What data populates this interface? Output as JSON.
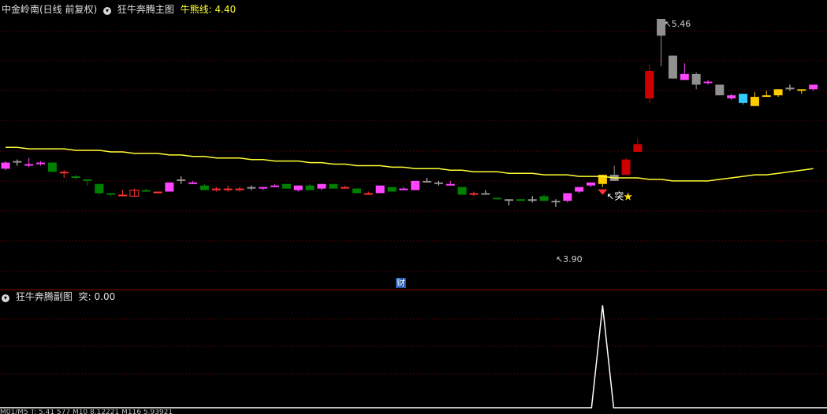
{
  "main_header": {
    "stock": "中金岭南(日线 前复权)",
    "indicator": "狂牛奔腾主图",
    "line_label": "牛熊线: 4.40",
    "colors": {
      "stock": "#e0e0e0",
      "indicator": "#e0e0e0",
      "line_label": "#ffff33"
    }
  },
  "sub_header": {
    "indicator": "狂牛奔腾副图",
    "value_label": "突: 0.00"
  },
  "annotations": {
    "high": "5.46",
    "low": "3.90",
    "signal": "突",
    "signal_icon": "star",
    "finance_badge": "财"
  },
  "bottom_strip": "M01/M5 T: 5.41 577 M10 8.12221 M116 5.93921",
  "colors": {
    "background": "#000000",
    "grid": "#8b0000",
    "up": "#ff44ff",
    "down": "#008000",
    "doji": "#ff3333",
    "bull_line": "#ffff33",
    "gray": "#909090",
    "red_solid": "#cc0000",
    "gold": "#ffcc00",
    "blue": "#33ccff",
    "sub_line": "#ffffff"
  },
  "chart_data": {
    "type": "candlestick",
    "bull_bear_line": [
      4.62,
      4.62,
      4.61,
      4.61,
      4.61,
      4.61,
      4.6,
      4.6,
      4.6,
      4.59,
      4.59,
      4.58,
      4.58,
      4.58,
      4.57,
      4.57,
      4.56,
      4.56,
      4.55,
      4.55,
      4.55,
      4.54,
      4.54,
      4.53,
      4.53,
      4.53,
      4.52,
      4.52,
      4.51,
      4.51,
      4.5,
      4.5,
      4.5,
      4.49,
      4.49,
      4.48,
      4.48,
      4.48,
      4.47,
      4.47,
      4.46,
      4.46,
      4.46,
      4.45,
      4.45,
      4.45,
      4.44,
      4.44,
      4.44,
      4.43,
      4.43,
      4.43,
      4.42,
      4.42,
      4.42,
      4.41,
      4.41,
      4.4,
      4.4,
      4.4,
      4.4,
      4.41,
      4.42,
      4.43,
      4.44,
      4.44,
      4.45,
      4.46,
      4.47,
      4.48
    ],
    "candles": [
      {
        "o": 4.52,
        "c": 4.48,
        "h": 4.53,
        "l": 4.47,
        "k": "up"
      },
      {
        "o": 4.53,
        "c": 4.52,
        "h": 4.54,
        "l": 4.5,
        "k": "gray"
      },
      {
        "o": 4.5,
        "c": 4.51,
        "h": 4.55,
        "l": 4.49,
        "k": "up"
      },
      {
        "o": 4.52,
        "c": 4.51,
        "h": 4.53,
        "l": 4.5,
        "k": "up"
      },
      {
        "o": 4.52,
        "c": 4.46,
        "h": 4.52,
        "l": 4.46,
        "k": "down"
      },
      {
        "o": 4.46,
        "c": 4.45,
        "h": 4.47,
        "l": 4.42,
        "k": "doji"
      },
      {
        "o": 4.43,
        "c": 4.42,
        "h": 4.44,
        "l": 4.41,
        "k": "down"
      },
      {
        "o": 4.41,
        "c": 4.4,
        "h": 4.41,
        "l": 4.37,
        "k": "down"
      },
      {
        "o": 4.38,
        "c": 4.32,
        "h": 4.38,
        "l": 4.31,
        "k": "down"
      },
      {
        "o": 4.32,
        "c": 4.31,
        "h": 4.32,
        "l": 4.3,
        "k": "down"
      },
      {
        "o": 4.3,
        "c": 4.31,
        "h": 4.34,
        "l": 4.3,
        "k": "doji"
      },
      {
        "o": 4.3,
        "c": 4.34,
        "h": 4.35,
        "l": 4.3,
        "k": "hollow"
      },
      {
        "o": 4.34,
        "c": 4.33,
        "h": 4.35,
        "l": 4.33,
        "k": "down"
      },
      {
        "o": 4.33,
        "c": 4.32,
        "h": 4.33,
        "l": 4.32,
        "k": "doji"
      },
      {
        "o": 4.33,
        "c": 4.39,
        "h": 4.39,
        "l": 4.33,
        "k": "up"
      },
      {
        "o": 4.41,
        "c": 4.4,
        "h": 4.43,
        "l": 4.38,
        "k": "gray"
      },
      {
        "o": 4.38,
        "c": 4.39,
        "h": 4.4,
        "l": 4.38,
        "k": "up"
      },
      {
        "o": 4.37,
        "c": 4.34,
        "h": 4.38,
        "l": 4.34,
        "k": "down"
      },
      {
        "o": 4.35,
        "c": 4.35,
        "h": 4.36,
        "l": 4.33,
        "k": "doji"
      },
      {
        "o": 4.35,
        "c": 4.35,
        "h": 4.37,
        "l": 4.33,
        "k": "doji"
      },
      {
        "o": 4.35,
        "c": 4.34,
        "h": 4.36,
        "l": 4.33,
        "k": "doji"
      },
      {
        "o": 4.35,
        "c": 4.36,
        "h": 4.37,
        "l": 4.34,
        "k": "gray"
      },
      {
        "o": 4.35,
        "c": 4.36,
        "h": 4.36,
        "l": 4.34,
        "k": "up"
      },
      {
        "o": 4.36,
        "c": 4.37,
        "h": 4.38,
        "l": 4.36,
        "k": "up"
      },
      {
        "o": 4.38,
        "c": 4.35,
        "h": 4.38,
        "l": 4.35,
        "k": "down"
      },
      {
        "o": 4.34,
        "c": 4.37,
        "h": 4.37,
        "l": 4.33,
        "k": "up"
      },
      {
        "o": 4.37,
        "c": 4.34,
        "h": 4.38,
        "l": 4.34,
        "k": "down"
      },
      {
        "o": 4.35,
        "c": 4.38,
        "h": 4.38,
        "l": 4.34,
        "k": "up"
      },
      {
        "o": 4.38,
        "c": 4.35,
        "h": 4.38,
        "l": 4.35,
        "k": "down"
      },
      {
        "o": 4.36,
        "c": 4.35,
        "h": 4.37,
        "l": 4.35,
        "k": "doji"
      },
      {
        "o": 4.35,
        "c": 4.32,
        "h": 4.35,
        "l": 4.32,
        "k": "down"
      },
      {
        "o": 4.32,
        "c": 4.32,
        "h": 4.33,
        "l": 4.31,
        "k": "doji"
      },
      {
        "o": 4.32,
        "c": 4.37,
        "h": 4.37,
        "l": 4.32,
        "k": "up"
      },
      {
        "o": 4.36,
        "c": 4.33,
        "h": 4.36,
        "l": 4.33,
        "k": "down"
      },
      {
        "o": 4.34,
        "c": 4.35,
        "h": 4.36,
        "l": 4.34,
        "k": "up"
      },
      {
        "o": 4.34,
        "c": 4.4,
        "h": 4.4,
        "l": 4.34,
        "k": "up"
      },
      {
        "o": 4.4,
        "c": 4.4,
        "h": 4.42,
        "l": 4.39,
        "k": "gray"
      },
      {
        "o": 4.39,
        "c": 4.38,
        "h": 4.4,
        "l": 4.37,
        "k": "gray"
      },
      {
        "o": 4.37,
        "c": 4.38,
        "h": 4.4,
        "l": 4.37,
        "k": "up"
      },
      {
        "o": 4.36,
        "c": 4.31,
        "h": 4.36,
        "l": 4.31,
        "k": "down"
      },
      {
        "o": 4.32,
        "c": 4.31,
        "h": 4.33,
        "l": 4.3,
        "k": "doji"
      },
      {
        "o": 4.32,
        "c": 4.32,
        "h": 4.34,
        "l": 4.31,
        "k": "gray"
      },
      {
        "o": 4.29,
        "c": 4.28,
        "h": 4.29,
        "l": 4.28,
        "k": "down"
      },
      {
        "o": 4.28,
        "c": 4.28,
        "h": 4.28,
        "l": 4.24,
        "k": "gray"
      },
      {
        "o": 4.28,
        "c": 4.27,
        "h": 4.28,
        "l": 4.27,
        "k": "down"
      },
      {
        "o": 4.28,
        "c": 4.28,
        "h": 4.3,
        "l": 4.26,
        "k": "gray"
      },
      {
        "o": 4.27,
        "c": 4.3,
        "h": 4.31,
        "l": 4.27,
        "k": "down"
      },
      {
        "o": 4.27,
        "c": 4.27,
        "h": 4.28,
        "l": 4.23,
        "k": "gray"
      },
      {
        "o": 4.27,
        "c": 4.32,
        "h": 4.32,
        "l": 4.26,
        "k": "up"
      },
      {
        "o": 4.33,
        "c": 4.36,
        "h": 4.36,
        "l": 4.32,
        "k": "up"
      },
      {
        "o": 4.37,
        "c": 4.39,
        "h": 4.39,
        "l": 4.36,
        "k": "up"
      },
      {
        "o": 4.38,
        "c": 4.44,
        "h": 4.44,
        "l": 4.36,
        "k": "gold"
      },
      {
        "o": 4.4,
        "c": 4.44,
        "h": 4.5,
        "l": 4.4,
        "k": "gray"
      },
      {
        "o": 4.44,
        "c": 4.54,
        "h": 4.55,
        "l": 4.44,
        "k": "red"
      },
      {
        "o": 4.59,
        "c": 4.64,
        "h": 4.68,
        "l": 4.59,
        "k": "red"
      },
      {
        "o": 4.94,
        "c": 5.12,
        "h": 5.16,
        "l": 4.91,
        "k": "red"
      },
      {
        "o": 5.35,
        "c": 5.46,
        "h": 5.46,
        "l": 5.15,
        "k": "gray"
      },
      {
        "o": 5.22,
        "c": 5.07,
        "h": 5.22,
        "l": 5.07,
        "k": "gray"
      },
      {
        "o": 5.1,
        "c": 5.06,
        "h": 5.17,
        "l": 5.06,
        "k": "up"
      },
      {
        "o": 5.1,
        "c": 5.03,
        "h": 5.11,
        "l": 5.0,
        "k": "gray"
      },
      {
        "o": 5.05,
        "c": 5.04,
        "h": 5.06,
        "l": 5.03,
        "k": "up"
      },
      {
        "o": 5.03,
        "c": 4.96,
        "h": 5.03,
        "l": 4.96,
        "k": "gray"
      },
      {
        "o": 4.96,
        "c": 4.94,
        "h": 4.97,
        "l": 4.93,
        "k": "up"
      },
      {
        "o": 4.97,
        "c": 4.91,
        "h": 4.97,
        "l": 4.9,
        "k": "blue"
      },
      {
        "o": 4.95,
        "c": 4.89,
        "h": 4.98,
        "l": 4.89,
        "k": "gold"
      },
      {
        "o": 4.96,
        "c": 4.96,
        "h": 4.99,
        "l": 4.95,
        "k": "gold"
      },
      {
        "o": 4.96,
        "c": 5.0,
        "h": 5.0,
        "l": 4.95,
        "k": "gold"
      },
      {
        "o": 5.01,
        "c": 5.01,
        "h": 5.03,
        "l": 4.99,
        "k": "gray"
      },
      {
        "o": 5.0,
        "c": 4.99,
        "h": 5.0,
        "l": 4.97,
        "k": "gold"
      },
      {
        "o": 5.0,
        "c": 5.03,
        "h": 5.03,
        "l": 4.99,
        "k": "up"
      }
    ],
    "sub_series": {
      "name": "突",
      "peak_index": 51,
      "peak_value": 1.0,
      "values_else": 0
    }
  }
}
